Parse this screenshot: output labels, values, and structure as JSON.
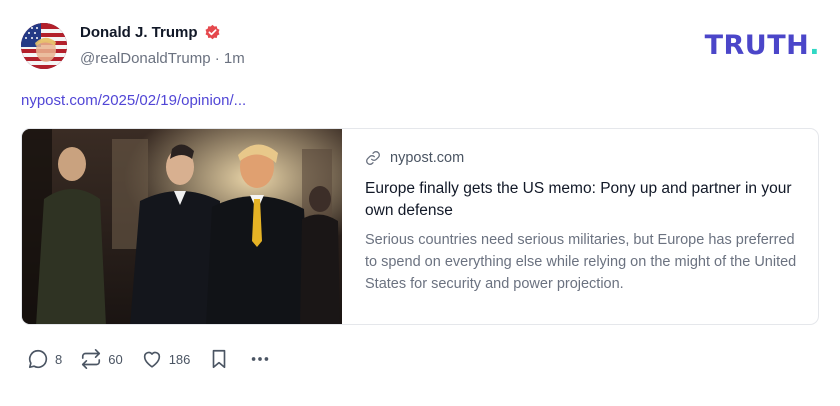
{
  "author": {
    "name": "Donald J. Trump",
    "handle": "@realDonaldTrump",
    "separator": "·",
    "time": "1m"
  },
  "logo": {
    "text": "TRUTH",
    "dot": "."
  },
  "post": {
    "link_text": "nypost.com/2025/02/19/opinion/..."
  },
  "card": {
    "domain": "nypost.com",
    "title": "Europe finally gets the US memo: Pony up and partner in your own defense",
    "description": "Serious countries need serious militaries, but Europe has preferred to spend on everything else while relying on the might of the United States for security and power projection."
  },
  "actions": {
    "replies": "8",
    "retruths": "60",
    "likes": "186"
  },
  "colors": {
    "brand": "#4b46c9",
    "brand_dot": "#31d8c4",
    "link": "#5146d6",
    "verified": "#e5484d"
  }
}
